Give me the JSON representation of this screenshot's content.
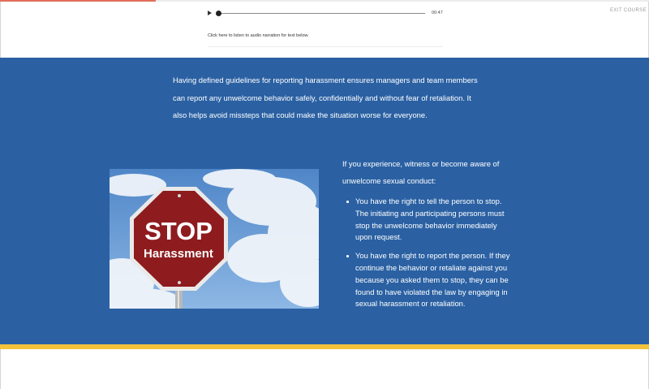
{
  "course_progress_percent": 24,
  "header": {
    "exit_label": "EXIT COURSE"
  },
  "audio": {
    "time": "00:47",
    "position_percent": 0,
    "narration_link": "Click here to listen to audio narration for text below."
  },
  "content": {
    "intro": "Having defined guidelines for reporting harassment ensures managers and team members can report any unwelcome behavior safely, confidentially and without fear of retaliation. It also helps avoid missteps that could make the situation worse for everyone.",
    "image": {
      "sign_line1": "STOP",
      "sign_line2": "Harassment"
    },
    "side_intro": "If you experience, witness or become aware of unwelcome sexual conduct:",
    "rights": [
      "You have the right to tell the person to stop. The initiating and participating persons must stop the unwelcome behavior immediately upon request.",
      "You have the right to report the person. If they continue the behavior or retaliate against you because you asked them to stop, they can be found to have violated the law by engaging in sexual harassment or retaliation."
    ]
  },
  "colors": {
    "band": "#2b61a3",
    "accent_stripe": "#f4c33b",
    "progress": "#e26d5a",
    "sign_red": "#8e1b1e"
  }
}
